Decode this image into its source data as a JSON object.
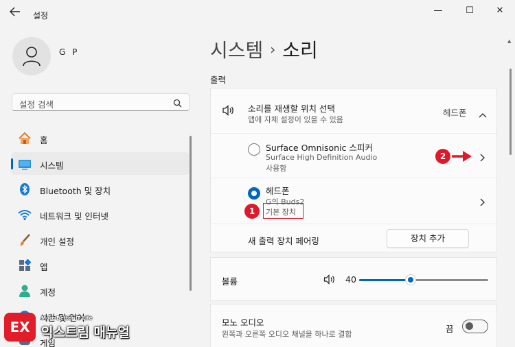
{
  "window": {
    "title": "설정",
    "minimize_glyph": "—",
    "maximize_glyph": "☐",
    "close_glyph": "✕"
  },
  "user": {
    "name": "G P"
  },
  "search": {
    "placeholder": "설정 검색"
  },
  "sidebar": {
    "items": [
      {
        "label": "홈",
        "icon": "home-icon"
      },
      {
        "label": "시스템",
        "icon": "system-icon",
        "active": true
      },
      {
        "label": "Bluetooth 및 장치",
        "icon": "bluetooth-icon"
      },
      {
        "label": "네트워크 및 인터넷",
        "icon": "wifi-icon"
      },
      {
        "label": "개인 설정",
        "icon": "paintbrush-icon"
      },
      {
        "label": "앱",
        "icon": "apps-icon"
      },
      {
        "label": "계정",
        "icon": "account-icon"
      },
      {
        "label": "시간 및 언어",
        "icon": "time-language-icon"
      },
      {
        "label": "게임",
        "icon": "gaming-icon"
      }
    ]
  },
  "breadcrumb": {
    "parent": "시스템",
    "separator": "›",
    "current": "소리"
  },
  "output": {
    "section_title": "출력",
    "header": {
      "title": "소리를 재생할 위치 선택",
      "subtitle": "앱에 자체 설정이 있을 수 있음",
      "value": "헤드폰"
    },
    "devices": [
      {
        "name": "Surface Omnisonic 스피커",
        "line1": "Surface High Definition Audio",
        "line2": "사용함",
        "selected": false
      },
      {
        "name": "헤드폰",
        "line1": "G의 Buds2",
        "line2": "기본 장치",
        "selected": true
      }
    ],
    "pair_label": "새 출력 장치 페어링",
    "add_device_label": "장치 추가"
  },
  "volume": {
    "label": "볼륨",
    "value": "40",
    "level": 0.4
  },
  "mono": {
    "title": "모노 오디오",
    "subtitle": "왼쪽과 오른쪽 오디오 채널을 하나로 결합",
    "state_label": "끔"
  },
  "annotations": {
    "badge1": "1",
    "badge2": "2"
  },
  "watermark": {
    "logo_text": "EX",
    "tagline": "More Better IT Life",
    "brand": "익스트림 매뉴얼"
  },
  "colors": {
    "accent": "#0067c0",
    "annotation": "#e0192a"
  }
}
